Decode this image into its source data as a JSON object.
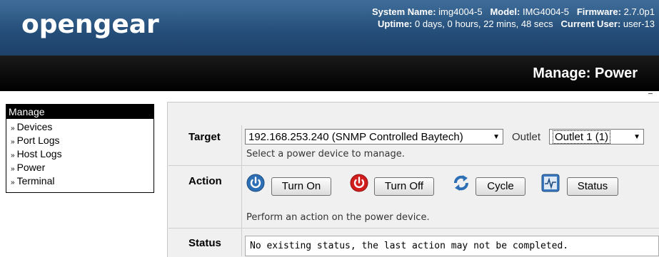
{
  "header": {
    "logo_text": "opengear",
    "system_name_label": "System Name:",
    "system_name": "img4004-5",
    "model_label": "Model:",
    "model": "IMG4004-5",
    "firmware_label": "Firmware:",
    "firmware": "2.7.0p1",
    "uptime_label": "Uptime:",
    "uptime": "0 days, 0 hours, 22 mins, 48 secs",
    "current_user_label": "Current User:",
    "current_user": "user-13",
    "brand_color": "#2a527d"
  },
  "page_title": "Manage: Power",
  "sidebar": {
    "heading": "Manage",
    "items": [
      {
        "label": "Devices"
      },
      {
        "label": "Port Logs"
      },
      {
        "label": "Host Logs"
      },
      {
        "label": "Power"
      },
      {
        "label": "Terminal"
      }
    ]
  },
  "target": {
    "label": "Target",
    "device_selected": "192.168.253.240 (SNMP Controlled Baytech)",
    "outlet_label": "Outlet",
    "outlet_selected": "Outlet 1 (1)",
    "hint": "Select a power device to manage."
  },
  "action": {
    "label": "Action",
    "turn_on": "Turn On",
    "turn_off": "Turn Off",
    "cycle": "Cycle",
    "status": "Status",
    "hint": "Perform an action on the power device."
  },
  "status": {
    "label": "Status",
    "text": "No existing status, the last action may not be completed."
  }
}
